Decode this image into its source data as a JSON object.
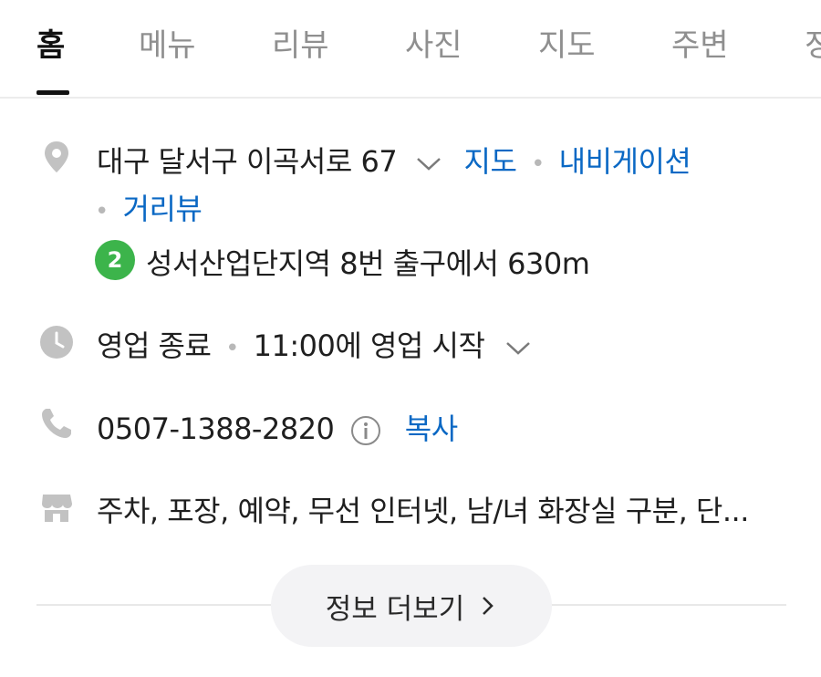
{
  "tabs": [
    {
      "label": "홈"
    },
    {
      "label": "메뉴"
    },
    {
      "label": "리뷰"
    },
    {
      "label": "사진"
    },
    {
      "label": "지도"
    },
    {
      "label": "주변"
    },
    {
      "label": "정"
    }
  ],
  "address": {
    "text": "대구 달서구 이곡서로 67",
    "map_link": "지도",
    "navigation_link": "내비게이션",
    "street_view_link": "거리뷰",
    "separator": "•"
  },
  "subway": {
    "line": "2",
    "line_color": "#3cb44b",
    "directions": "성서산업단지역 8번 출구에서 630m"
  },
  "hours": {
    "status": "영업 종료",
    "separator": "•",
    "next_open": "11:00에 영업 시작"
  },
  "phone": {
    "number": "0507-1388-2820",
    "copy_label": "복사"
  },
  "amenities": {
    "text": "주차, 포장, 예약, 무선 인터넷, 남/녀 화장실 구분, 단..."
  },
  "more_info": {
    "label": "정보 더보기"
  },
  "colors": {
    "link": "#0a68c4",
    "icon_gray": "#c2c2c2"
  }
}
